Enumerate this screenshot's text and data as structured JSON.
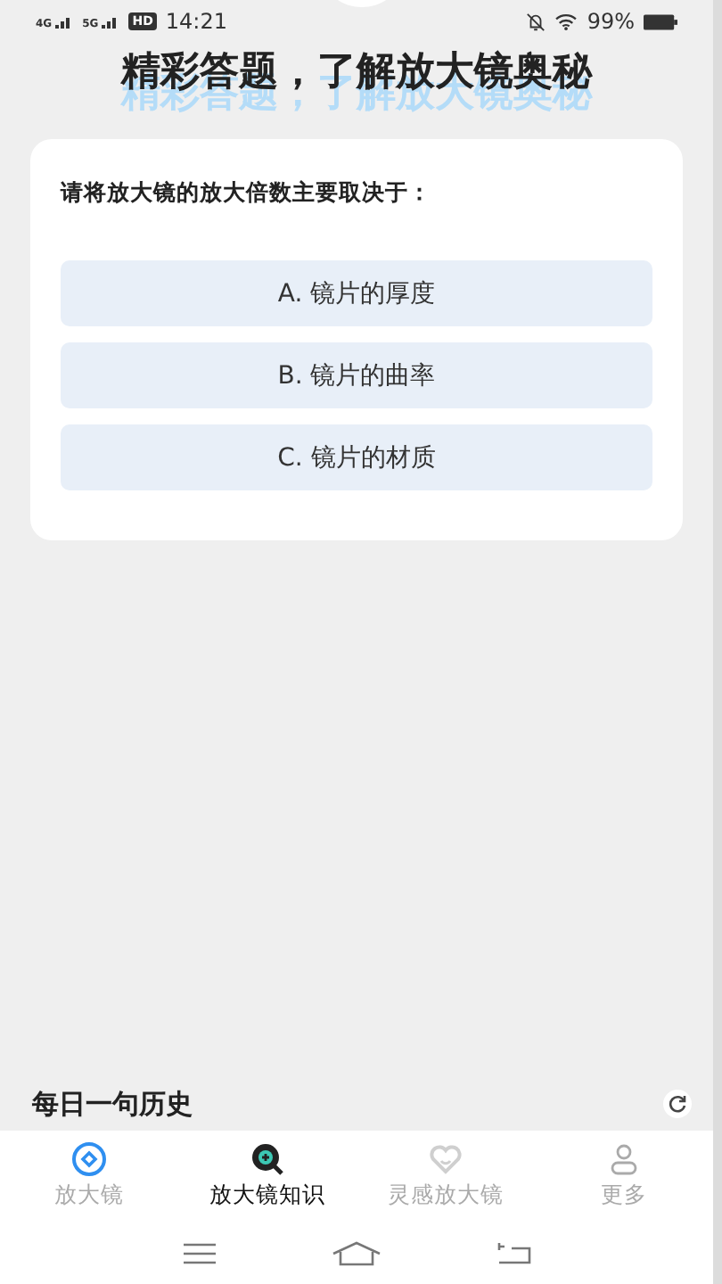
{
  "status_bar": {
    "network_1": "4G",
    "network_2": "5G",
    "hd": "HD",
    "time": "14:21",
    "battery": "99%"
  },
  "title": "精彩答题，了解放大镜奥秘",
  "quiz": {
    "question": "请将放大镜的放大倍数主要取决于：",
    "options": [
      {
        "label": "A. 镜片的厚度",
        "selected": false
      },
      {
        "label": "B. 镜片的曲率",
        "selected": false
      },
      {
        "label": "C. 镜片的材质",
        "selected": false
      }
    ]
  },
  "daily": {
    "title": "每日一句历史"
  },
  "tabs": [
    {
      "label": "放大镜",
      "selected": false
    },
    {
      "label": "放大镜知识",
      "selected": true
    },
    {
      "label": "灵感放大镜",
      "selected": false
    },
    {
      "label": "更多",
      "selected": false
    }
  ]
}
